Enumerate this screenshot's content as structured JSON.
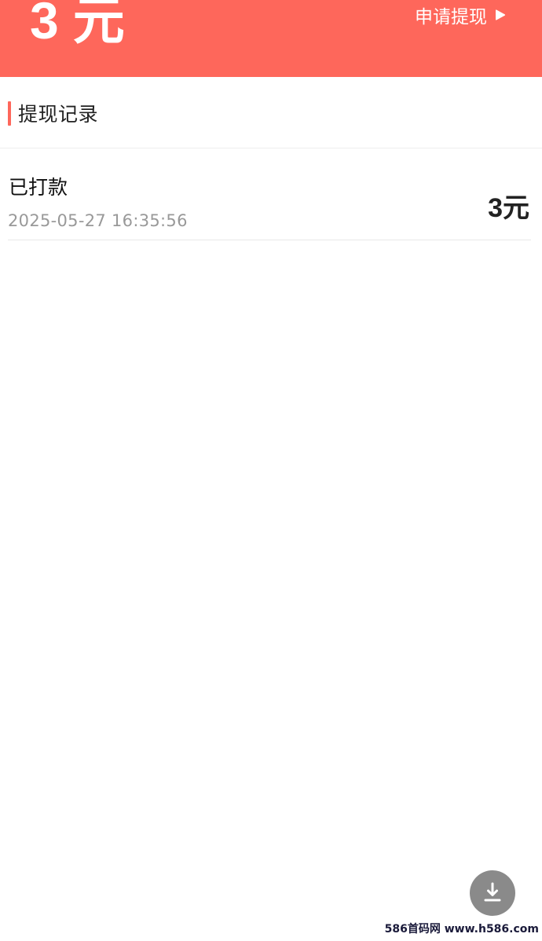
{
  "header": {
    "balance_number": "3",
    "balance_unit": "元",
    "withdraw_label": "申请提现",
    "bg_color": "#fe675b"
  },
  "records_section": {
    "title": "提现记录",
    "items": [
      {
        "status": "已打款",
        "time": "2025-05-27 16:35:56",
        "amount": "3元"
      }
    ]
  },
  "fab": {
    "icon": "download-icon"
  },
  "watermark": {
    "text": "586首码网 www.h586.com"
  }
}
